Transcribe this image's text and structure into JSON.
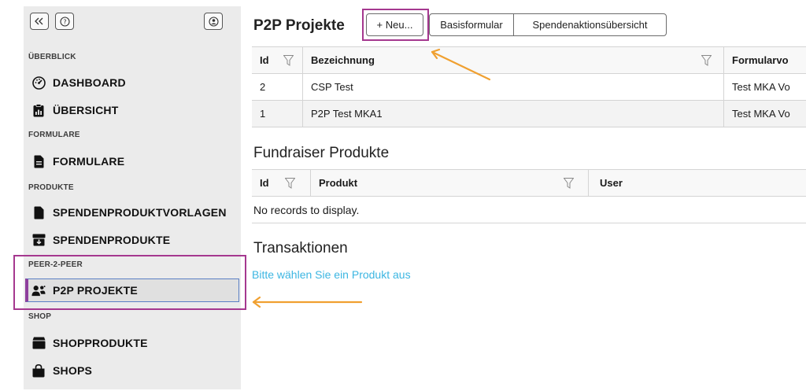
{
  "sidebar": {
    "top_buttons": {
      "collapse": "collapse",
      "help": "help",
      "user": "user"
    },
    "sections": {
      "overview": "ÜBERBLICK",
      "forms": "FORMULARE",
      "products": "PRODUKTE",
      "p2p": "PEER-2-PEER",
      "shop": "SHOP"
    },
    "items": {
      "dashboard": "DASHBOARD",
      "overview": "ÜBERSICHT",
      "forms": "FORMULARE",
      "product_templates": "SPENDENPRODUKTVORLAGEN",
      "products": "SPENDENPRODUKTE",
      "p2p_projects": "P2P PROJEKTE",
      "shop_products": "SHOPPRODUKTE",
      "shops": "SHOPS"
    }
  },
  "main": {
    "p2p": {
      "title": "P2P Projekte",
      "buttons": {
        "new": "+ Neu...",
        "basic_form": "Basisformular",
        "campaign_overview": "Spendenaktionsübersicht"
      },
      "columns": [
        "Id",
        "Bezeichnung",
        "Formularvo"
      ],
      "rows": [
        [
          "2",
          "CSP Test",
          "Test MKA Vo"
        ],
        [
          "1",
          "P2P Test MKA1",
          "Test MKA Vo"
        ]
      ]
    },
    "fundraiser": {
      "title": "Fundraiser Produkte",
      "columns": [
        "Id",
        "Produkt",
        "User"
      ],
      "empty": "No records to display."
    },
    "transactions": {
      "title": "Transaktionen",
      "hint": "Bitte wählen Sie ein Produkt aus"
    }
  },
  "colors": {
    "annotation_box": "#a5388f",
    "annotation_arrow": "#f0a030",
    "link": "#3cb6e2",
    "active_bar": "#8e3f9d"
  }
}
